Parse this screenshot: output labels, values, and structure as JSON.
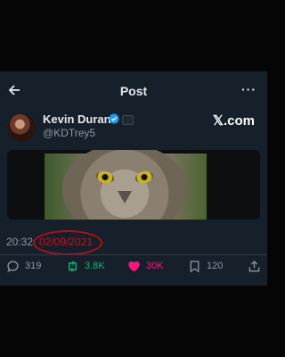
{
  "header": {
    "title": "Post",
    "more_label": "···"
  },
  "author": {
    "name": "Kevin Durant",
    "handle": "@KDTrey5"
  },
  "brand": {
    "label": "𝕏.com"
  },
  "post": {
    "time": "20:32",
    "date": "02/09/2021",
    "image_alt": "owl-close-up"
  },
  "actions": {
    "replies": "319",
    "reposts": "3.8K",
    "likes": "30K",
    "bookmarks": "120"
  },
  "colors": {
    "background": "#15202b",
    "like": "#f91880",
    "repost": "#00ba7c",
    "highlight": "#c9101a"
  }
}
